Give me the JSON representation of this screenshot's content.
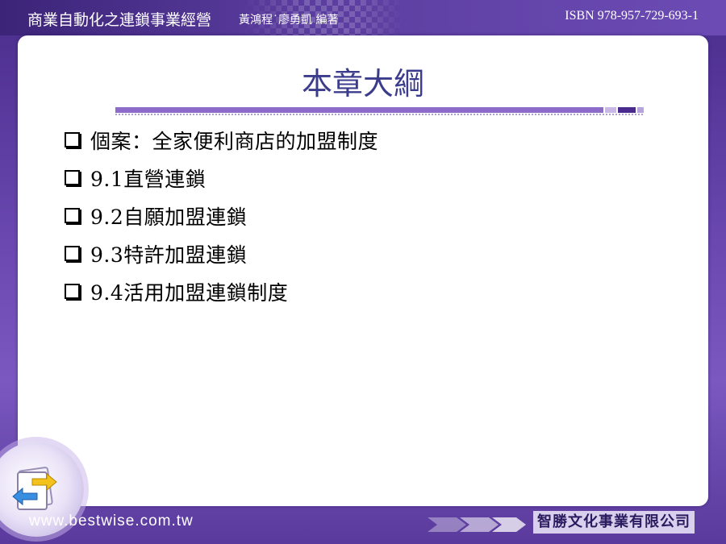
{
  "header": {
    "book_title": "商業自動化之連鎖事業經營",
    "authors": "黃鴻程˙廖勇凱 編著",
    "isbn": "ISBN 978-957-729-693-1"
  },
  "slide": {
    "title": "本章大綱",
    "items": [
      {
        "label": "個案：全家便利商店的加盟制度"
      },
      {
        "label": "9.1直營連鎖"
      },
      {
        "label": "9.2自願加盟連鎖"
      },
      {
        "label": "9.3特許加盟連鎖"
      },
      {
        "label": "9.4活用加盟連鎖制度"
      }
    ]
  },
  "footer": {
    "website": "www.bestwise.com.tw",
    "publisher": "智勝文化事業有限公司"
  },
  "colors": {
    "background": "#5b3a9e",
    "title": "#3c3c8c",
    "accent_bar": "#8c6cc8",
    "panel": "#ffffff"
  },
  "icons": {
    "bullet": "checkbox-square-icon",
    "nav": "back-forward-arrows-icon",
    "footer_arrows": "chevron-arrows-icon"
  }
}
